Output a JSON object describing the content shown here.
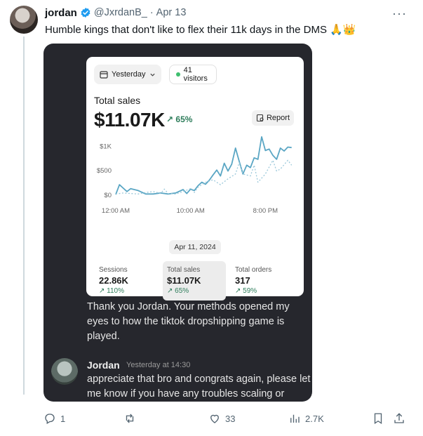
{
  "tweet": {
    "author_name": "jordan",
    "handle": "@JxrdanB_",
    "separator": "·",
    "date": "Apr 13",
    "text": "Humble kings that don't like to flex their 11k days in the DMS 🙏👑"
  },
  "shopify_card": {
    "period_label": "Yesterday",
    "visitors_label": "41 visitors",
    "total_sales_label": "Total sales",
    "total_sales_value": "$11.07K",
    "total_sales_change": "65%",
    "report_label": "Report",
    "date_label": "Apr 11, 2024",
    "metrics": [
      {
        "label": "Sessions",
        "value": "22.86K",
        "change": "110%"
      },
      {
        "label": "Total sales",
        "value": "$11.07K",
        "change": "65%"
      },
      {
        "label": "Total orders",
        "value": "317",
        "change": "59%"
      }
    ]
  },
  "chart_data": {
    "type": "line",
    "y_ticks": [
      "$1K",
      "$500",
      "$0"
    ],
    "x_ticks": [
      "12:00 AM",
      "10:00 AM",
      "8:00 PM"
    ],
    "ylim": [
      0,
      1150
    ],
    "x_range": [
      0,
      24
    ],
    "series": [
      {
        "style": "solid",
        "color": "#5aa6c4",
        "x": [
          0,
          0.5,
          1,
          1.5,
          2,
          3,
          4,
          5,
          6,
          7,
          8,
          9,
          9.5,
          10,
          10.5,
          11,
          11.5,
          12,
          12.5,
          13,
          13.5,
          14,
          14.5,
          15,
          15.5,
          16,
          16.5,
          17,
          17.5,
          18,
          18.5,
          19,
          19.5,
          20,
          20.5,
          21,
          21.5,
          22,
          22.5,
          23,
          23.5
        ],
        "y": [
          0,
          200,
          130,
          60,
          120,
          80,
          10,
          10,
          30,
          10,
          30,
          100,
          20,
          110,
          80,
          180,
          250,
          210,
          290,
          400,
          500,
          380,
          640,
          480,
          620,
          950,
          680,
          420,
          600,
          550,
          750,
          720,
          1180,
          900,
          930,
          800,
          720,
          950,
          890,
          970,
          960
        ]
      },
      {
        "style": "dotted",
        "color": "#9bc8da",
        "x": [
          0,
          1,
          2,
          3,
          4,
          5,
          6,
          6.5,
          7,
          8,
          9,
          10,
          10.5,
          11,
          12,
          13,
          14,
          15,
          16,
          16.5,
          17,
          18,
          18.5,
          19,
          20,
          21,
          21.5,
          22,
          23,
          23.5
        ],
        "y": [
          10,
          30,
          20,
          10,
          40,
          60,
          20,
          110,
          20,
          10,
          60,
          120,
          40,
          150,
          250,
          300,
          200,
          320,
          420,
          650,
          420,
          380,
          600,
          250,
          420,
          700,
          480,
          520,
          700,
          600
        ]
      }
    ]
  },
  "dm": {
    "message_text": "Thank you Jordan. Your methods opened my eyes to how the tiktok dropshipping game is played.",
    "reply_name": "Jordan",
    "reply_time": "Yesterday at 14:30",
    "reply_text": "appreciate that bro and congrats again, please let me know if you have any troubles scaling or"
  },
  "actions": {
    "replies": "1",
    "reposts": "",
    "likes": "33",
    "views": "2.7K"
  },
  "colors": {
    "accent_blue": "#1d9bf0",
    "positive_green": "#2e7d5b",
    "media_bg": "#26272d"
  }
}
